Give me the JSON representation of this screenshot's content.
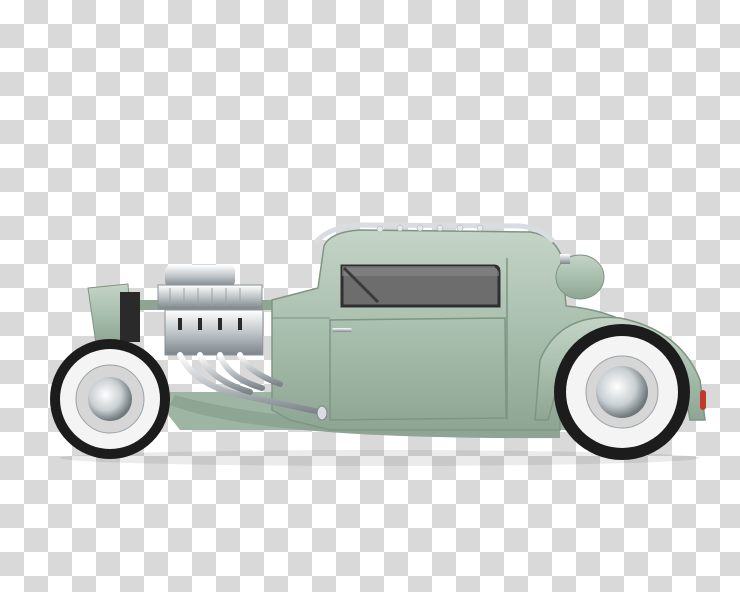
{
  "image": {
    "subject": "hot-rod-coupe",
    "background": "transparency-checkerboard",
    "colors": {
      "body": "#a9bfae",
      "body_shadow": "#8ea593",
      "body_highlight": "#c4d4c7",
      "tire": "#1c1c1c",
      "whitewall": "#f4f4f4",
      "chrome": "#d8dde0",
      "window": "#6d6d6d",
      "checker_dark": "#d9d9d9",
      "checker_light": "#ffffff"
    }
  }
}
